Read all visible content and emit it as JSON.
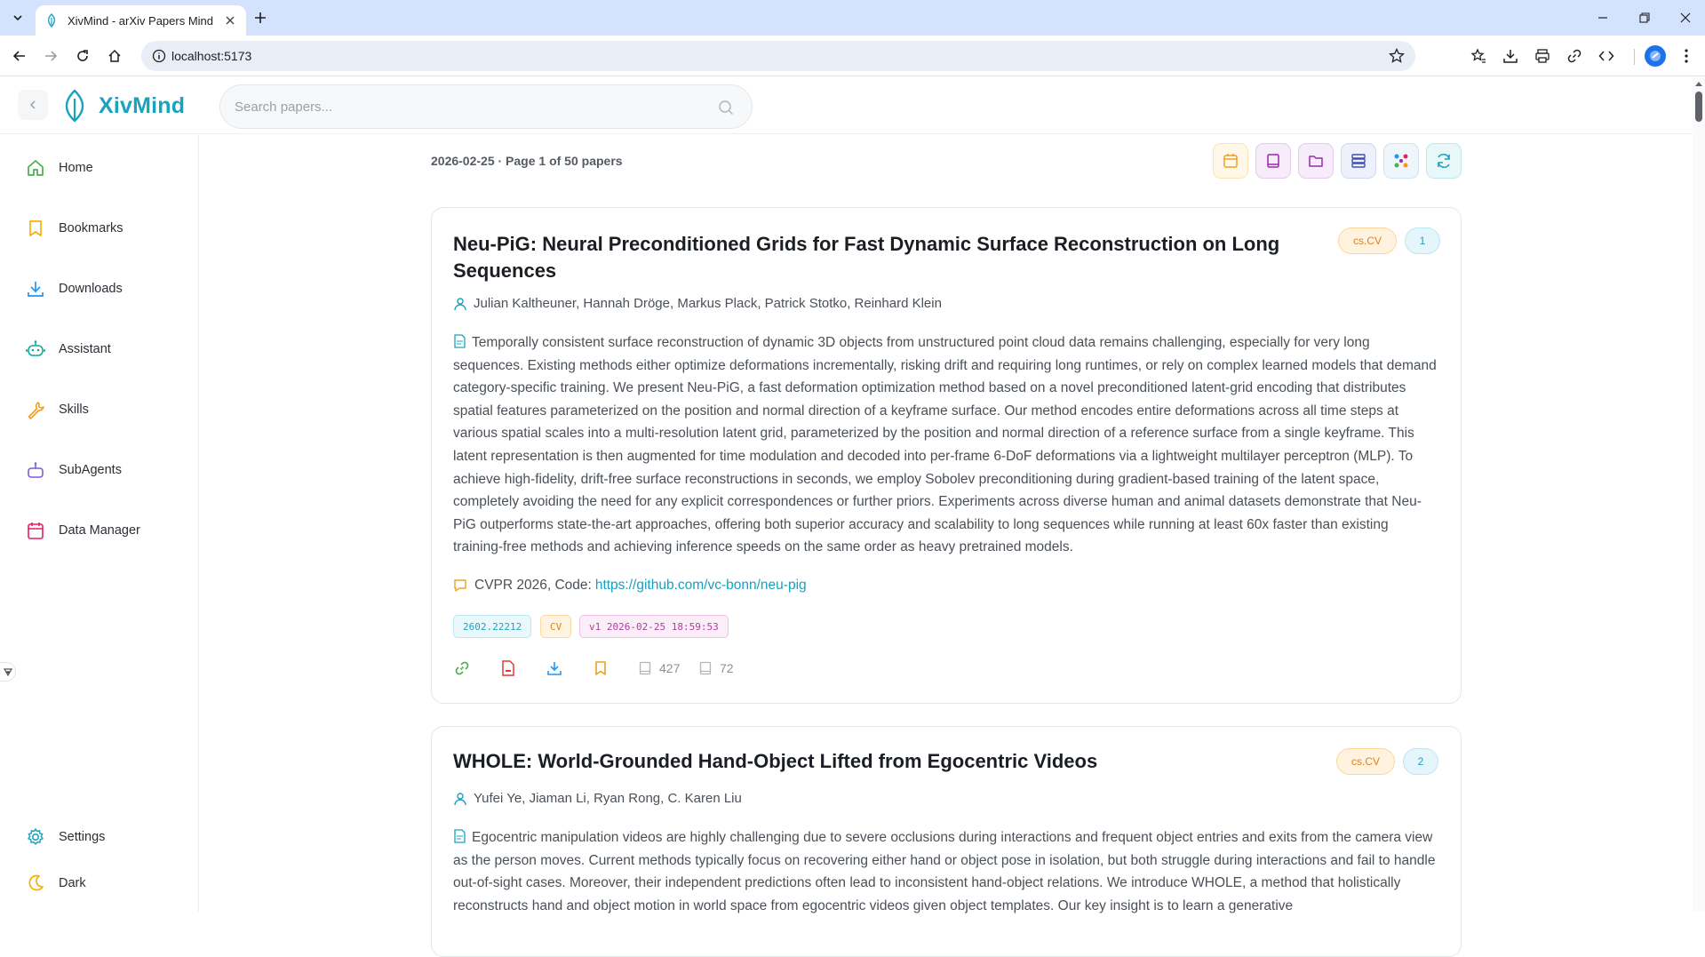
{
  "browser": {
    "tab_title": "XivMind - arXiv Papers Mind",
    "url": "localhost:5173"
  },
  "app": {
    "brand": "XivMind",
    "search_placeholder": "Search papers..."
  },
  "sidebar": {
    "items": [
      {
        "label": "Home",
        "icon": "home-icon"
      },
      {
        "label": "Bookmarks",
        "icon": "bookmark-icon"
      },
      {
        "label": "Downloads",
        "icon": "download-icon"
      },
      {
        "label": "Assistant",
        "icon": "robot-icon"
      },
      {
        "label": "Skills",
        "icon": "wrench-icon"
      },
      {
        "label": "SubAgents",
        "icon": "subagent-icon"
      },
      {
        "label": "Data Manager",
        "icon": "calendar-icon"
      }
    ],
    "settings_label": "Settings",
    "theme_label": "Dark"
  },
  "main": {
    "meta": "2026-02-25 · Page 1 of 50 papers",
    "view_buttons": [
      "calendar-icon",
      "book-icon",
      "folder-icon",
      "list-icon",
      "graph-icon",
      "refresh-icon"
    ],
    "papers": [
      {
        "title": "Neu-PiG: Neural Preconditioned Grids for Fast Dynamic Surface Reconstruction on Long Sequences",
        "category": "cs.CV",
        "rank": "1",
        "authors": "Julian Kaltheuner, Hannah Dröge, Markus Plack, Patrick Stotko, Reinhard Klein",
        "abstract": "Temporally consistent surface reconstruction of dynamic 3D objects from unstructured point cloud data remains challenging, especially for very long sequences. Existing methods either optimize deformations incrementally, risking drift and requiring long runtimes, or rely on complex learned models that demand category-specific training. We present Neu-PiG, a fast deformation optimization method based on a novel preconditioned latent-grid encoding that distributes spatial features parameterized on the position and normal direction of a keyframe surface. Our method encodes entire deformations across all time steps at various spatial scales into a multi-resolution latent grid, parameterized by the position and normal direction of a reference surface from a single keyframe. This latent representation is then augmented for time modulation and decoded into per-frame 6-DoF deformations via a lightweight multilayer perceptron (MLP). To achieve high-fidelity, drift-free surface reconstructions in seconds, we employ Sobolev preconditioning during gradient-based training of the latent space, completely avoiding the need for any explicit correspondences or further priors. Experiments across diverse human and animal datasets demonstrate that Neu-PiG outperforms state-the-art approaches, offering both superior accuracy and scalability to long sequences while running at least 60x faster than existing training-free methods and achieving inference speeds on the same order as heavy pretrained models.",
        "comment_prefix": "CVPR 2026, Code:",
        "comment_link": "https://github.com/vc-bonn/neu-pig",
        "tags": [
          "2602.22212",
          "CV",
          "v1 2026-02-25 18:59:53"
        ],
        "stat_pages": "427",
        "stat_refs": "72"
      },
      {
        "title": "WHOLE: World-Grounded Hand-Object Lifted from Egocentric Videos",
        "category": "cs.CV",
        "rank": "2",
        "authors": "Yufei Ye, Jiaman Li, Ryan Rong, C. Karen Liu",
        "abstract": "Egocentric manipulation videos are highly challenging due to severe occlusions during interactions and frequent object entries and exits from the camera view as the person moves. Current methods typically focus on recovering either hand or object pose in isolation, but both struggle during interactions and fail to handle out-of-sight cases. Moreover, their independent predictions often lead to inconsistent hand-object relations. We introduce WHOLE, a method that holistically reconstructs hand and object motion in world space from egocentric videos given object templates. Our key insight is to learn a generative"
      }
    ]
  },
  "colors": {
    "brand": "#1ba3bd",
    "category_badge": "#e0821b",
    "link": "#1a9fbf"
  }
}
